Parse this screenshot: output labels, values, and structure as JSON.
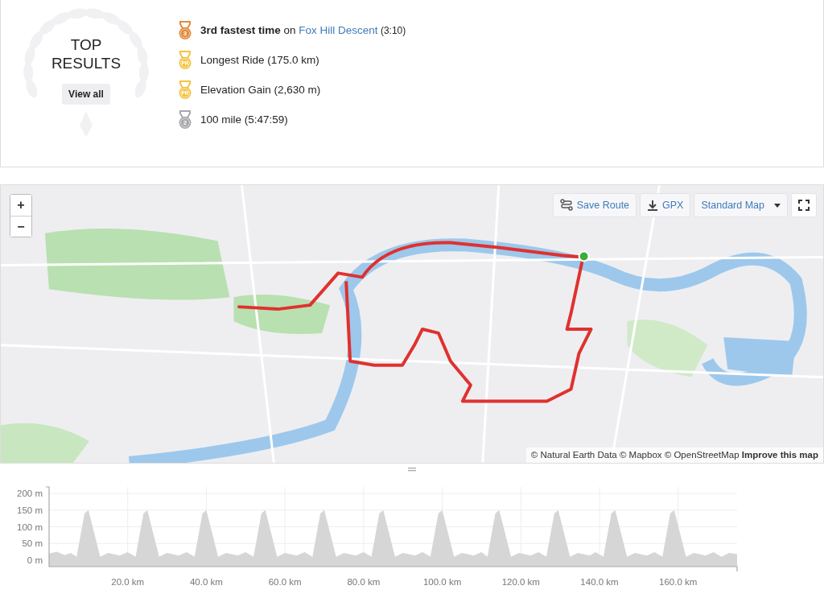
{
  "top_results": {
    "title": "TOP RESULTS",
    "view_all": "View all",
    "achievements": [
      {
        "medal": {
          "kind": "bronze",
          "label": "3"
        },
        "text": "**3rd fastest time** on ",
        "link": "Fox Hill Descent",
        "suffix": "(3:10)"
      },
      {
        "medal": {
          "kind": "pr",
          "label": "PR"
        },
        "text": "Longest Ride (175.0 km)"
      },
      {
        "medal": {
          "kind": "pr",
          "label": "PR"
        },
        "text": "Elevation Gain (2,630 m)"
      },
      {
        "medal": {
          "kind": "silver",
          "label": "2"
        },
        "text": "100 mile (5:47:59)"
      }
    ]
  },
  "map": {
    "kind": "picture",
    "zoom_in": "+",
    "zoom_out": "−",
    "toolbar": [
      {
        "kind": "route",
        "label": "Save Route"
      },
      {
        "kind": "download",
        "label": "GPX"
      },
      {
        "kind": "dropdown",
        "label": "Standard Map"
      },
      {
        "kind": "fullscreen"
      }
    ],
    "attribution": "© Natural Earth Data © Mapbox © OpenStreetMap",
    "improve_link": "Improve this map"
  },
  "elevation": {
    "chart_data": {
      "type": "area",
      "xlim": [
        0,
        175
      ],
      "ylim": [
        0,
        200
      ],
      "yticks": [
        {
          "value": 0,
          "label": "0 m"
        },
        {
          "value": 50,
          "label": "50 m"
        },
        {
          "value": 100,
          "label": "100 m"
        },
        {
          "value": 150,
          "label": "150 m"
        },
        {
          "value": 200,
          "label": "200 m"
        }
      ],
      "xticks": [
        {
          "value": 20,
          "label": "20.0 km"
        },
        {
          "value": 40,
          "label": "40.0 km"
        },
        {
          "value": 60,
          "label": "60.0 km"
        },
        {
          "value": 80,
          "label": "80.0 km"
        },
        {
          "value": 100,
          "label": "100.0 km"
        },
        {
          "value": 120,
          "label": "120.0 km"
        },
        {
          "value": 140,
          "label": "140.0 km"
        },
        {
          "value": 160,
          "label": "160.0 km"
        }
      ],
      "x": [
        0,
        2,
        4,
        5.5,
        7,
        9,
        10,
        13,
        15,
        18,
        20,
        22,
        24,
        25,
        28,
        30,
        33,
        35,
        37,
        39,
        40,
        43,
        45,
        48,
        50,
        52,
        54,
        55,
        58,
        60,
        63,
        65,
        67,
        69,
        70,
        73,
        75,
        78,
        80,
        82,
        84,
        85,
        88,
        90,
        93,
        95,
        97,
        99,
        100,
        103,
        105,
        108,
        110,
        111.5,
        113.5,
        114.5,
        117.5,
        119.5,
        122.5,
        124.5,
        126.5,
        128.5,
        129.5,
        132.5,
        134.5,
        137.5,
        139,
        141,
        143,
        144,
        147,
        149,
        152,
        154,
        156,
        158,
        159,
        162,
        164,
        167,
        169,
        171,
        173,
        175
      ],
      "grid": true,
      "series": [
        {
          "color": "#d6d6d6",
          "values": [
            20,
            25,
            15,
            22,
            10,
            140,
            150,
            10,
            22,
            14,
            24,
            10,
            140,
            150,
            10,
            22,
            14,
            24,
            10,
            140,
            150,
            10,
            22,
            14,
            24,
            10,
            140,
            150,
            10,
            22,
            14,
            24,
            10,
            140,
            150,
            10,
            22,
            14,
            24,
            10,
            140,
            150,
            10,
            22,
            14,
            24,
            10,
            140,
            150,
            10,
            22,
            14,
            24,
            10,
            140,
            150,
            10,
            22,
            14,
            24,
            10,
            140,
            150,
            10,
            22,
            14,
            24,
            10,
            140,
            150,
            10,
            22,
            14,
            24,
            10,
            140,
            150,
            10,
            22,
            14,
            24,
            10,
            22,
            18
          ]
        }
      ]
    }
  }
}
